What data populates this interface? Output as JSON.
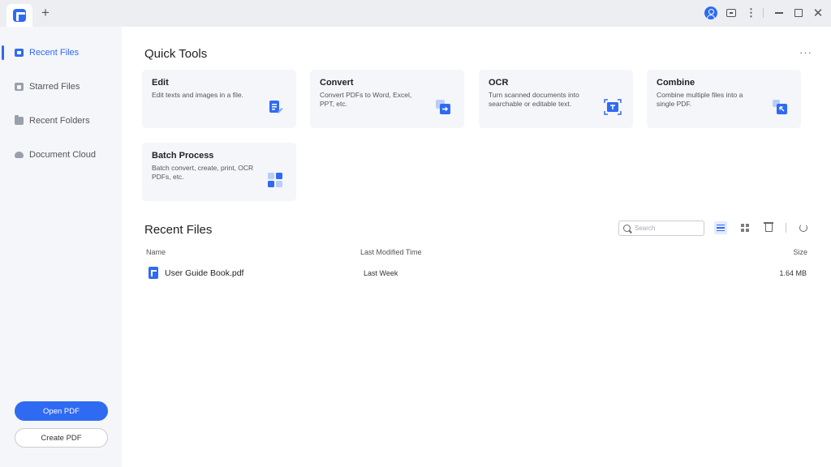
{
  "titlebar": {
    "new_tab_symbol": "+",
    "icons": [
      "app-logo-icon",
      "plus-icon",
      "user-icon",
      "feedback-icon",
      "more-icon",
      "minimize-icon",
      "maximize-icon",
      "close-icon"
    ],
    "more_symbol": "⋮",
    "close_symbol": "✕"
  },
  "sidebar": {
    "items": [
      {
        "label": "Recent Files",
        "icon": "recent-files-icon",
        "active": true
      },
      {
        "label": "Starred Files",
        "icon": "star-icon",
        "active": false
      },
      {
        "label": "Recent Folders",
        "icon": "folder-icon",
        "active": false
      },
      {
        "label": "Document Cloud",
        "icon": "cloud-icon",
        "active": false
      }
    ],
    "open_pdf_label": "Open PDF",
    "create_pdf_label": "Create PDF"
  },
  "quick_tools": {
    "title": "Quick Tools",
    "more_symbol": "···",
    "cards": [
      {
        "title": "Edit",
        "desc": "Edit texts and images in a file.",
        "icon": "edit-icon"
      },
      {
        "title": "Convert",
        "desc": "Convert PDFs to Word, Excel, PPT, etc.",
        "icon": "convert-icon"
      },
      {
        "title": "OCR",
        "desc": "Turn scanned documents into searchable or editable text.",
        "icon": "ocr-icon"
      },
      {
        "title": "Combine",
        "desc": "Combine multiple files into a single PDF.",
        "icon": "combine-icon"
      },
      {
        "title": "Batch Process",
        "desc": "Batch convert, create, print, OCR PDFs, etc.",
        "icon": "batch-process-icon"
      }
    ]
  },
  "recent_files": {
    "title": "Recent Files",
    "search_placeholder": "Search",
    "columns": {
      "name": "Name",
      "modified": "Last Modified Time",
      "size": "Size"
    },
    "rows": [
      {
        "name": "User Guide Book.pdf",
        "modified": "Last Week",
        "size": "1.64 MB"
      }
    ]
  },
  "colors": {
    "accent": "#2f6bf2",
    "sidebar_bg": "#f5f6f9",
    "card_bg": "#f5f6f9",
    "titlebar_bg": "#edeef1"
  }
}
